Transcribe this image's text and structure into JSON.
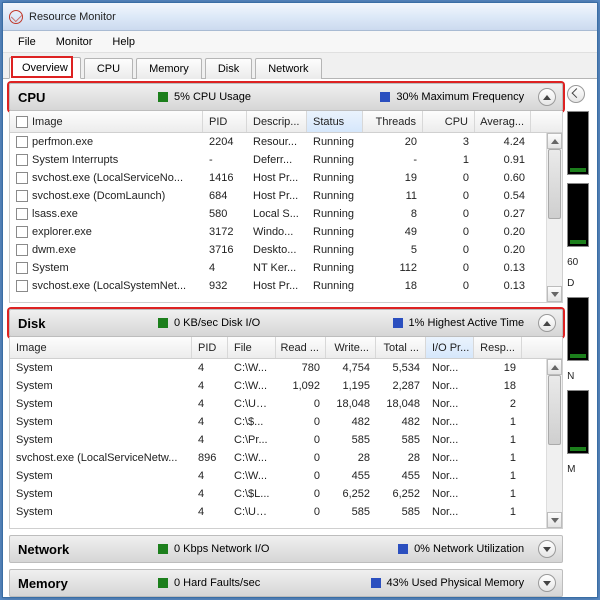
{
  "window": {
    "title": "Resource Monitor"
  },
  "menu": {
    "file": "File",
    "monitor": "Monitor",
    "help": "Help"
  },
  "tabs": {
    "overview": "Overview",
    "cpu": "CPU",
    "memory": "Memory",
    "disk": "Disk",
    "network": "Network"
  },
  "colors": {
    "green": "#1c7f1c",
    "blue": "#2b4fbf"
  },
  "cpu": {
    "title": "CPU",
    "stat1_value": "5% CPU Usage",
    "stat2_value": "30% Maximum Frequency",
    "cols": {
      "image": "Image",
      "pid": "PID",
      "desc": "Descrip...",
      "status": "Status",
      "threads": "Threads",
      "cpu": "CPU",
      "avg": "Averag..."
    },
    "rows": [
      {
        "image": "perfmon.exe",
        "pid": "2204",
        "desc": "Resour...",
        "status": "Running",
        "threads": "20",
        "cpu": "3",
        "avg": "4.24"
      },
      {
        "image": "System Interrupts",
        "pid": "-",
        "desc": "Deferr...",
        "status": "Running",
        "threads": "-",
        "cpu": "1",
        "avg": "0.91"
      },
      {
        "image": "svchost.exe (LocalServiceNo...",
        "pid": "1416",
        "desc": "Host Pr...",
        "status": "Running",
        "threads": "19",
        "cpu": "0",
        "avg": "0.60"
      },
      {
        "image": "svchost.exe (DcomLaunch)",
        "pid": "684",
        "desc": "Host Pr...",
        "status": "Running",
        "threads": "11",
        "cpu": "0",
        "avg": "0.54"
      },
      {
        "image": "lsass.exe",
        "pid": "580",
        "desc": "Local S...",
        "status": "Running",
        "threads": "8",
        "cpu": "0",
        "avg": "0.27"
      },
      {
        "image": "explorer.exe",
        "pid": "3172",
        "desc": "Windo...",
        "status": "Running",
        "threads": "49",
        "cpu": "0",
        "avg": "0.20"
      },
      {
        "image": "dwm.exe",
        "pid": "3716",
        "desc": "Deskto...",
        "status": "Running",
        "threads": "5",
        "cpu": "0",
        "avg": "0.20"
      },
      {
        "image": "System",
        "pid": "4",
        "desc": "NT Ker...",
        "status": "Running",
        "threads": "112",
        "cpu": "0",
        "avg": "0.13"
      },
      {
        "image": "svchost.exe (LocalSystemNet...",
        "pid": "932",
        "desc": "Host Pr...",
        "status": "Running",
        "threads": "18",
        "cpu": "0",
        "avg": "0.13"
      }
    ]
  },
  "disk": {
    "title": "Disk",
    "stat1_value": "0 KB/sec Disk I/O",
    "stat2_value": "1% Highest Active Time",
    "cols": {
      "image": "Image",
      "pid": "PID",
      "file": "File",
      "read": "Read ...",
      "write": "Write...",
      "total": "Total ...",
      "iopr": "I/O Pr...",
      "resp": "Resp..."
    },
    "rows": [
      {
        "image": "System",
        "pid": "4",
        "file": "C:\\W...",
        "read": "780",
        "write": "4,754",
        "total": "5,534",
        "iopr": "Nor...",
        "resp": "19"
      },
      {
        "image": "System",
        "pid": "4",
        "file": "C:\\W...",
        "read": "1,092",
        "write": "1,195",
        "total": "2,287",
        "iopr": "Nor...",
        "resp": "18"
      },
      {
        "image": "System",
        "pid": "4",
        "file": "C:\\Us...",
        "read": "0",
        "write": "18,048",
        "total": "18,048",
        "iopr": "Nor...",
        "resp": "2"
      },
      {
        "image": "System",
        "pid": "4",
        "file": "C:\\$...",
        "read": "0",
        "write": "482",
        "total": "482",
        "iopr": "Nor...",
        "resp": "1"
      },
      {
        "image": "System",
        "pid": "4",
        "file": "C:\\Pr...",
        "read": "0",
        "write": "585",
        "total": "585",
        "iopr": "Nor...",
        "resp": "1"
      },
      {
        "image": "svchost.exe (LocalServiceNetw...",
        "pid": "896",
        "file": "C:\\W...",
        "read": "0",
        "write": "28",
        "total": "28",
        "iopr": "Nor...",
        "resp": "1"
      },
      {
        "image": "System",
        "pid": "4",
        "file": "C:\\W...",
        "read": "0",
        "write": "455",
        "total": "455",
        "iopr": "Nor...",
        "resp": "1"
      },
      {
        "image": "System",
        "pid": "4",
        "file": "C:\\$L...",
        "read": "0",
        "write": "6,252",
        "total": "6,252",
        "iopr": "Nor...",
        "resp": "1"
      },
      {
        "image": "System",
        "pid": "4",
        "file": "C:\\Us...",
        "read": "0",
        "write": "585",
        "total": "585",
        "iopr": "Nor...",
        "resp": "1"
      }
    ]
  },
  "network": {
    "title": "Network",
    "stat1_value": "0 Kbps Network I/O",
    "stat2_value": "0% Network Utilization"
  },
  "memory": {
    "title": "Memory",
    "stat1_value": "0 Hard Faults/sec",
    "stat2_value": "43% Used Physical Memory"
  },
  "right": {
    "lbl60": "60",
    "lblD": "D",
    "lblN": "N",
    "lblM": "M"
  }
}
